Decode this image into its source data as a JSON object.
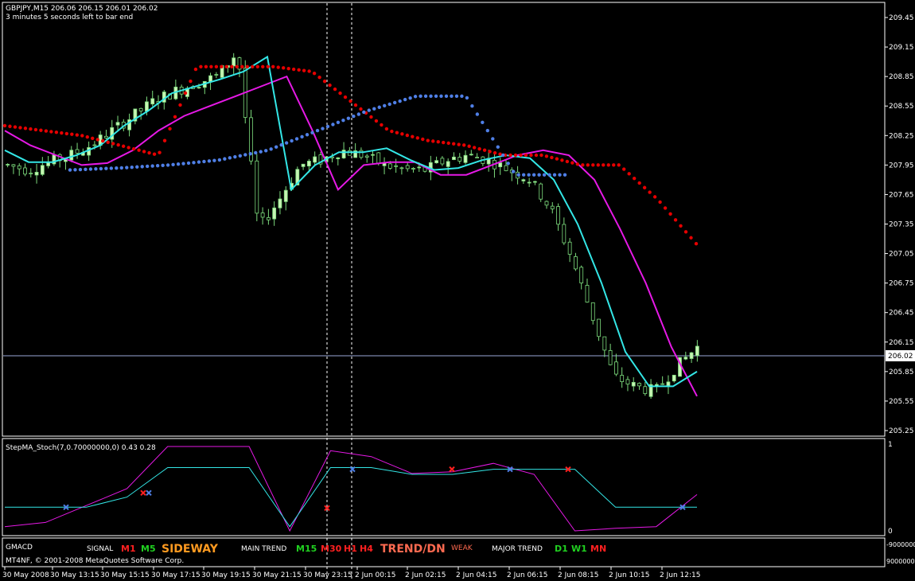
{
  "main": {
    "header_line1": "GBPJPY,M15  206.06 206.15 206.01 206.02",
    "header_line2": "3 minutes 5 seconds left to bar end",
    "price_labels": [
      "209.45",
      "209.15",
      "208.85",
      "208.55",
      "208.25",
      "207.95",
      "207.65",
      "207.35",
      "207.05",
      "206.75",
      "206.45",
      "206.15",
      "205.85",
      "205.55",
      "205.25"
    ],
    "current_price": "206.02"
  },
  "sub1": {
    "title": "StepMA_Stoch(7,0.70000000,0) 0.43 0.28",
    "label_top": "1",
    "label_bottom": "0"
  },
  "sub2": {
    "title": "GMACD",
    "copyright": "MT4NF, © 2001-2008 MetaQuotes Software Corp.",
    "signal_label": "SIGNAL",
    "signal_m1": "M1",
    "signal_m5": "M5",
    "signal_state": "SIDEWAY",
    "main_label": "MAIN TREND",
    "main_m15": "M15",
    "main_m30": "M30",
    "main_h1": "H1",
    "main_h4": "H4",
    "main_state": "TREND/DN",
    "main_strength": "WEAK",
    "major_label": "MAJOR TREND",
    "major_d1": "D1",
    "major_w1": "W1",
    "major_mn": "MN",
    "label_top": "-9000000",
    "label_bottom": "9000000"
  },
  "time_labels": [
    "30 May 2008",
    "30 May 13:15",
    "30 May 15:15",
    "30 May 17:15",
    "30 May 19:15",
    "30 May 21:15",
    "30 May 23:15",
    "2 Jun 00:15",
    "2 Jun 02:15",
    "2 Jun 04:15",
    "2 Jun 06:15",
    "2 Jun 08:15",
    "2 Jun 10:15",
    "2 Jun 12:15"
  ],
  "colors": {
    "background": "#000000",
    "frame": "#ffffff",
    "candle_up": "#c8f5b4",
    "candle_down": "#000000",
    "wick": "#7ddc7d",
    "fast_ma": "#33e6e6",
    "slow_ma": "#e619e6",
    "sar_upper": "#e60000",
    "sar_lower": "#4f7fe6",
    "signal_red": "#ff2020",
    "signal_green": "#20d020",
    "signal_orange": "#ff9a20",
    "trend_salmon": "#ff6a50"
  },
  "chart_data": [
    {
      "type": "candlestick",
      "title": "GBPJPY,M15",
      "ohlc_header": [
        206.06,
        206.15,
        206.01,
        206.02
      ],
      "ylim": [
        205.2,
        209.6
      ],
      "current_price": 206.02,
      "series": [
        {
          "name": "candles",
          "close_path": [
            207.95,
            207.9,
            207.98,
            208.05,
            208.15,
            208.3,
            208.45,
            208.6,
            208.7,
            208.78,
            208.85,
            209.1,
            207.3,
            207.6,
            207.95,
            208.0,
            208.1,
            208.05,
            207.95,
            207.9,
            207.9,
            208.0,
            208.05,
            208.0,
            207.9,
            207.8,
            207.5,
            207.0,
            206.4,
            205.8,
            205.7,
            205.65,
            205.9,
            206.1
          ]
        },
        {
          "name": "fast_ma",
          "values": [
            208.1,
            207.98,
            207.98,
            208.05,
            208.15,
            208.35,
            208.5,
            208.68,
            208.75,
            208.82,
            208.9,
            209.05,
            207.7,
            207.95,
            208.08,
            208.08,
            208.12,
            208.0,
            207.9,
            207.92,
            208.0,
            208.05,
            208.02,
            207.8,
            207.35,
            206.75,
            206.05,
            205.7,
            205.7,
            205.85
          ]
        },
        {
          "name": "slow_ma",
          "values": [
            208.3,
            208.15,
            208.05,
            207.95,
            207.97,
            208.1,
            208.3,
            208.45,
            208.55,
            208.65,
            208.75,
            208.85,
            208.3,
            207.7,
            207.95,
            207.98,
            207.98,
            207.85,
            207.85,
            207.95,
            208.05,
            208.1,
            208.05,
            207.8,
            207.3,
            206.75,
            206.1,
            205.6
          ]
        },
        {
          "name": "sar_upper",
          "values": [
            208.35,
            208.3,
            208.25,
            208.15,
            208.05,
            208.95,
            208.95,
            208.95,
            208.9,
            208.6,
            208.3,
            208.2,
            208.15,
            208.05,
            208.05,
            207.95,
            207.95,
            207.6,
            207.15
          ]
        },
        {
          "name": "sar_lower",
          "values": [
            207.9,
            207.92,
            207.95,
            208.0,
            208.1,
            208.3,
            208.5,
            208.65,
            208.65,
            207.85,
            207.85
          ]
        }
      ]
    },
    {
      "type": "line",
      "title": "StepMA_Stoch(7,0.70000000,0)",
      "ylim": [
        0,
        1
      ],
      "series": [
        {
          "name": "StepMA",
          "values": [
            0.28,
            0.28,
            0.28,
            0.4,
            0.75,
            0.75,
            0.75,
            0.05,
            0.75,
            0.75,
            0.67,
            0.67,
            0.73,
            0.73,
            0.73,
            0.28,
            0.28,
            0.28
          ]
        },
        {
          "name": "Stoch",
          "values": [
            0.05,
            0.1,
            0.3,
            0.5,
            1.0,
            1.0,
            1.0,
            0.0,
            0.95,
            0.88,
            0.68,
            0.7,
            0.8,
            0.67,
            0.0,
            0.03,
            0.05,
            0.43
          ]
        }
      ]
    }
  ]
}
